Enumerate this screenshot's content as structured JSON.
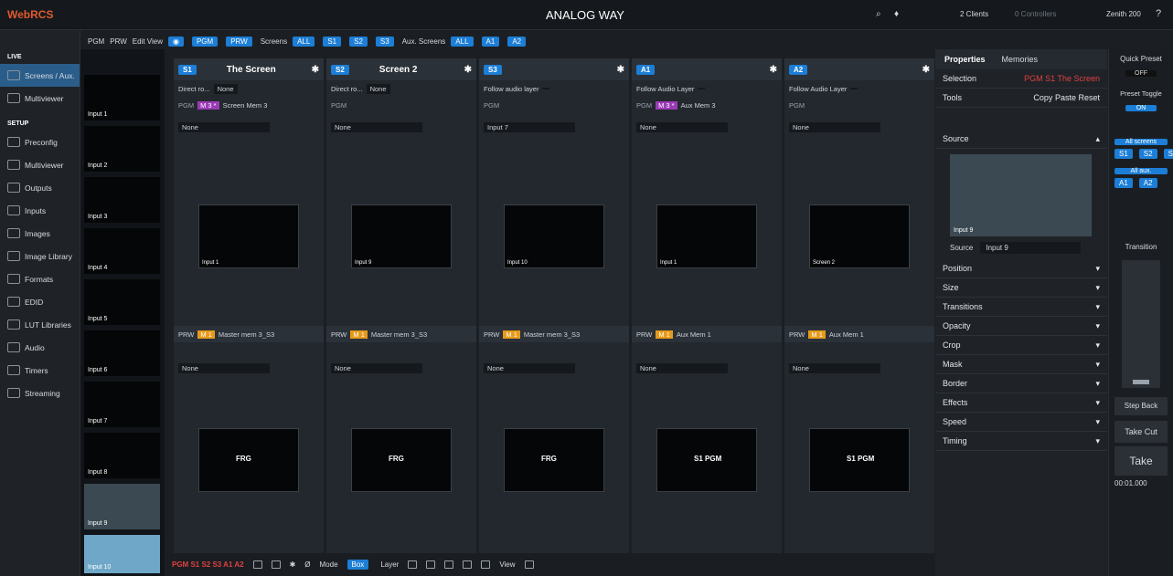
{
  "app": {
    "brand": "WebRCS",
    "center_title": "ANALOG WAY",
    "clients": "2 Clients",
    "controllers": "0 Controllers",
    "device": "Zenith 200"
  },
  "toolbar": {
    "pgm": "PGM",
    "prw": "PRW",
    "edit_view": "Edit View",
    "pgm_btn": "PGM",
    "prw_btn": "PRW",
    "screens_label": "Screens",
    "all": "ALL",
    "s1": "S1",
    "s2": "S2",
    "s3": "S3",
    "aux_label": "Aux. Screens",
    "aux_all": "ALL",
    "a1": "A1",
    "a2": "A2"
  },
  "nav": {
    "live": "LIVE",
    "screens_aux": "Screens / Aux.",
    "multiviewer": "Multiviewer",
    "setup": "SETUP",
    "items": [
      "Preconfig",
      "Multiviewer",
      "Outputs",
      "Inputs",
      "Images",
      "Image Library",
      "Formats",
      "EDID",
      "LUT Libraries",
      "Audio",
      "Timers",
      "Streaming"
    ]
  },
  "inputs": [
    "Input 1",
    "Input 2",
    "Input 3",
    "Input 4",
    "Input 5",
    "Input 6",
    "Input 7",
    "Input 8",
    "Input 9",
    "Input 10"
  ],
  "columns": [
    {
      "tag": "S1",
      "title": "The Screen",
      "audio": "Direct ro...",
      "audio_val": "None",
      "pgm": "PGM",
      "mem": "M 3 *",
      "mem_name": "Screen Mem 3",
      "layer_val": "None",
      "prev_label": "Input 1",
      "bottom_mode": "PRW",
      "bottom_mem": "M 1",
      "bottom_name": "Master mem 3_S3",
      "bottom_val": "None",
      "bottom_text": "FRG"
    },
    {
      "tag": "S2",
      "title": "Screen 2",
      "audio": "Direct ro...",
      "audio_val": "None",
      "pgm": "PGM",
      "mem": "",
      "mem_name": "",
      "layer_val": "None",
      "prev_label": "Input 9",
      "bottom_mode": "PRW",
      "bottom_mem": "M 1",
      "bottom_name": "Master mem 3_S3",
      "bottom_val": "None",
      "bottom_text": "FRG"
    },
    {
      "tag": "S3",
      "title": "",
      "audio": "Follow audio layer",
      "audio_val": "",
      "pgm": "PGM",
      "mem": "",
      "mem_name": "",
      "layer_val": "Input 7",
      "prev_label": "Input 10",
      "bottom_mode": "PRW",
      "bottom_mem": "M 1",
      "bottom_name": "Master mem 3_S3",
      "bottom_val": "None",
      "bottom_text": "FRG"
    },
    {
      "tag": "A1",
      "title": "",
      "audio": "Follow Audio Layer",
      "audio_val": "",
      "pgm": "PGM",
      "mem": "M 3 *",
      "mem_name": "Aux Mem 3",
      "layer_val": "None",
      "prev_label": "Input 1",
      "bottom_mode": "PRW",
      "bottom_mem": "M 1",
      "bottom_name": "Aux Mem 1",
      "bottom_val": "None",
      "bottom_text": "S1 PGM"
    },
    {
      "tag": "A2",
      "title": "",
      "audio": "Follow Audio Layer",
      "audio_val": "",
      "pgm": "PGM",
      "mem": "",
      "mem_name": "",
      "layer_val": "None",
      "prev_label": "Screen 2",
      "bottom_mode": "PRW",
      "bottom_mem": "M 1",
      "bottom_name": "Aux Mem 1",
      "bottom_val": "None",
      "bottom_text": "S1 PGM"
    }
  ],
  "props": {
    "tab1": "Properties",
    "tab2": "Memories",
    "selection": "Selection",
    "sel_val": "PGM S1 The Screen",
    "tools": "Tools",
    "copy": "Copy",
    "paste": "Paste",
    "reset": "Reset",
    "source": "Source",
    "src_input": "Input 9",
    "src_label": "Source",
    "src_val": "Input 9",
    "sections": [
      "Position",
      "Size",
      "Transitions",
      "Opacity",
      "Crop",
      "Mask",
      "Border",
      "Effects",
      "Speed",
      "Timing"
    ]
  },
  "quick": {
    "title": "Quick Preset",
    "off": "OFF",
    "toggle": "Preset Toggle",
    "on": "ON",
    "all_screens": "All screens",
    "s1": "S1",
    "s2": "S2",
    "s3": "S3",
    "all_aux": "All aux.",
    "a1": "A1",
    "a2": "A2",
    "transition": "Transition",
    "step_back": "Step Back",
    "take_cut": "Take Cut",
    "take": "Take",
    "time": "00:01.000"
  },
  "bottom": {
    "status": "PGM S1 S2 S3 A1 A2",
    "mode": "Mode",
    "box": "Box",
    "layer": "Layer",
    "view": "View"
  }
}
